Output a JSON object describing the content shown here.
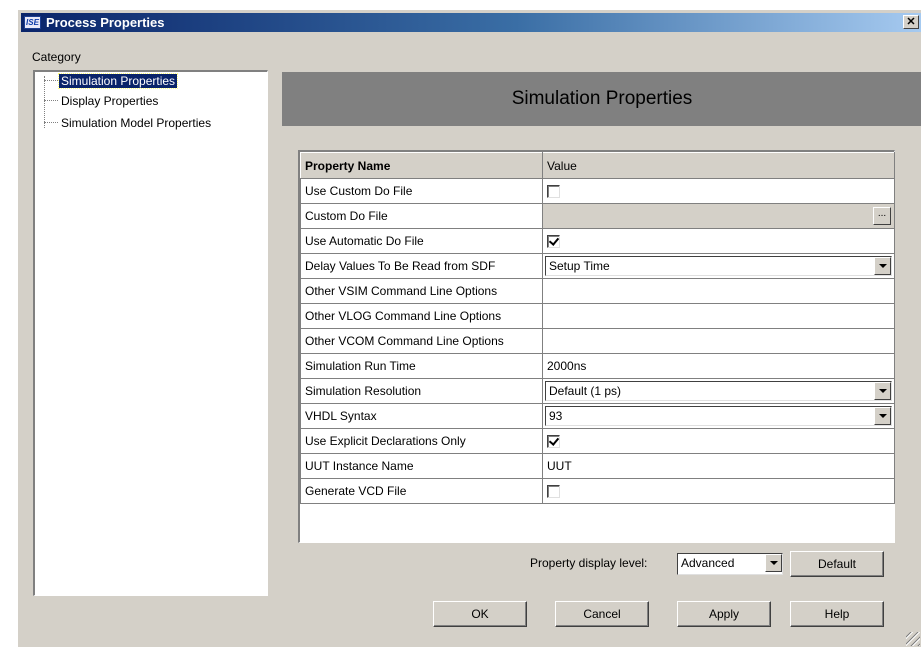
{
  "window": {
    "title": "Process Properties",
    "app_icon_text": "ISE",
    "close_glyph": "✕"
  },
  "category": {
    "label": "Category",
    "items": [
      {
        "label": "Simulation Properties",
        "selected": true
      },
      {
        "label": "Display Properties",
        "selected": false
      },
      {
        "label": "Simulation Model Properties",
        "selected": false
      }
    ]
  },
  "panel": {
    "title": "Simulation Properties"
  },
  "table": {
    "headers": {
      "name": "Property Name",
      "value": "Value"
    },
    "rows": [
      {
        "name": "Use Custom Do File",
        "type": "checkbox",
        "checked": false
      },
      {
        "name": "Custom Do File",
        "type": "file",
        "value": "",
        "button": "..."
      },
      {
        "name": "Use Automatic Do File",
        "type": "checkbox",
        "checked": true
      },
      {
        "name": "Delay Values To Be Read from SDF",
        "type": "dropdown",
        "value": "Setup Time"
      },
      {
        "name": "Other VSIM Command Line Options",
        "type": "text",
        "value": ""
      },
      {
        "name": "Other VLOG Command Line Options",
        "type": "text",
        "value": ""
      },
      {
        "name": "Other VCOM Command Line Options",
        "type": "text",
        "value": ""
      },
      {
        "name": "Simulation Run Time",
        "type": "text",
        "value": "2000ns"
      },
      {
        "name": "Simulation Resolution",
        "type": "dropdown",
        "value": "Default (1 ps)"
      },
      {
        "name": "VHDL Syntax",
        "type": "dropdown",
        "value": "93"
      },
      {
        "name": "Use Explicit Declarations Only",
        "type": "checkbox",
        "checked": true
      },
      {
        "name": "UUT Instance Name",
        "type": "text",
        "value": "UUT"
      },
      {
        "name": "Generate VCD File",
        "type": "checkbox",
        "checked": false
      }
    ]
  },
  "display_level": {
    "label": "Property display level:",
    "value": "Advanced"
  },
  "buttons": {
    "default": "Default",
    "ok": "OK",
    "cancel": "Cancel",
    "apply": "Apply",
    "help": "Help"
  }
}
